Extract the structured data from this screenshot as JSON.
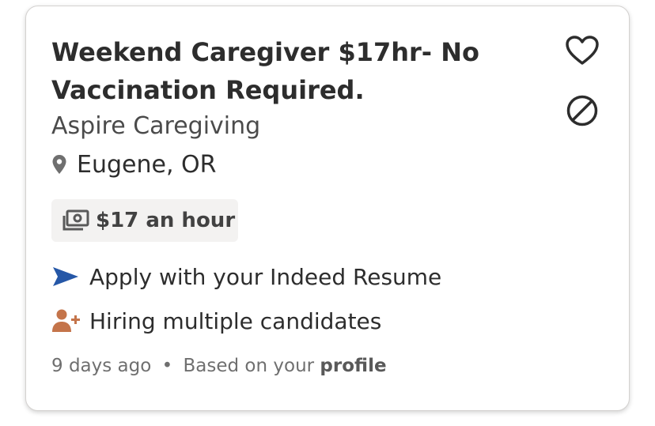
{
  "job": {
    "title": "Weekend Caregiver $17hr- No Vaccination Required.",
    "company": "Aspire Caregiving",
    "location": "Eugene, OR",
    "salary": "$17 an hour",
    "features": {
      "apply": "Apply with your Indeed Resume",
      "hiring": "Hiring multiple candidates"
    },
    "meta": {
      "posted": "9 days ago",
      "separator": "•",
      "based_on_prefix": "Based on your",
      "based_on_strong": "profile"
    }
  },
  "icons": {
    "save": "heart-icon",
    "dismiss": "block-icon",
    "location": "location-pin-icon",
    "salary": "money-icon",
    "apply": "send-arrow-icon",
    "hiring": "add-person-icon"
  },
  "colors": {
    "apply_icon": "#2557a7",
    "hiring_icon": "#c4744a",
    "title_text": "#2d2d2d",
    "muted_text": "#6f6f6f",
    "salary_bg": "#f3f2f1"
  }
}
